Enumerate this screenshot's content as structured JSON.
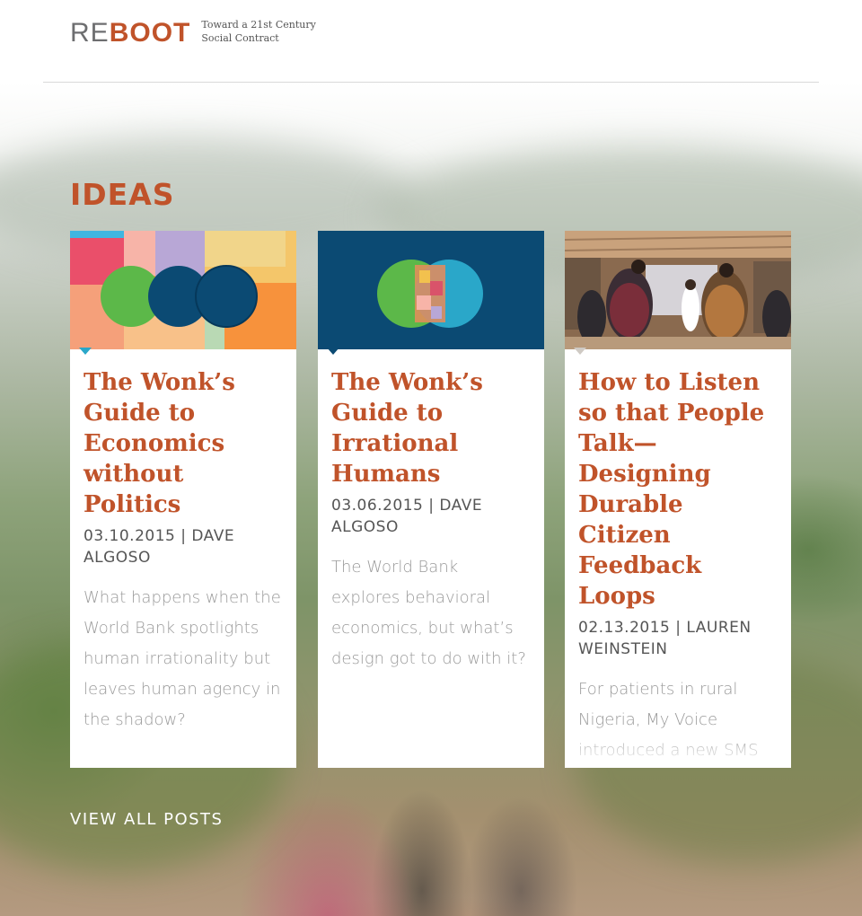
{
  "brand": {
    "logo_re": "RE",
    "logo_boot": "BOOT",
    "tagline_line1": "Toward a 21st Century",
    "tagline_line2": "Social Contract"
  },
  "section": {
    "title": "IDEAS"
  },
  "posts": [
    {
      "title": "The Wonk’s Guide to Economics without Politics",
      "date": "03.10.2015",
      "author": "DAVE ALGOSO",
      "excerpt": "What happens when the World Bank spotlights human irrationality but leaves human agency in the shadow?"
    },
    {
      "title": "The Wonk’s Guide to Irrational Humans",
      "date": "03.06.2015",
      "author": "DAVE ALGOSO",
      "excerpt": "The World Bank explores behavioral economics, but what’s design got to do with it?"
    },
    {
      "title": "How to Listen so that People Talk—Designing Durable Citizen Feedback Loops",
      "date": "02.13.2015",
      "author": "LAUREN WEINSTEIN",
      "excerpt": "For patients in rural Nigeria, My Voice introduced a new SMS survey technology, and a new concept, of providing and using"
    }
  ],
  "view_all": "VIEW ALL POSTS",
  "meta_separator": " | ",
  "colors": {
    "accent": "#c0532a",
    "logo_grey": "#6d6e70",
    "card_bg": "#ffffff",
    "notch": "#2aa7c9",
    "navy": "#0b4a73"
  },
  "icons": {
    "thumb1": "speech-bubbles-illustration",
    "thumb2": "venn-circles-illustration",
    "thumb3": "community-meeting-photo"
  }
}
